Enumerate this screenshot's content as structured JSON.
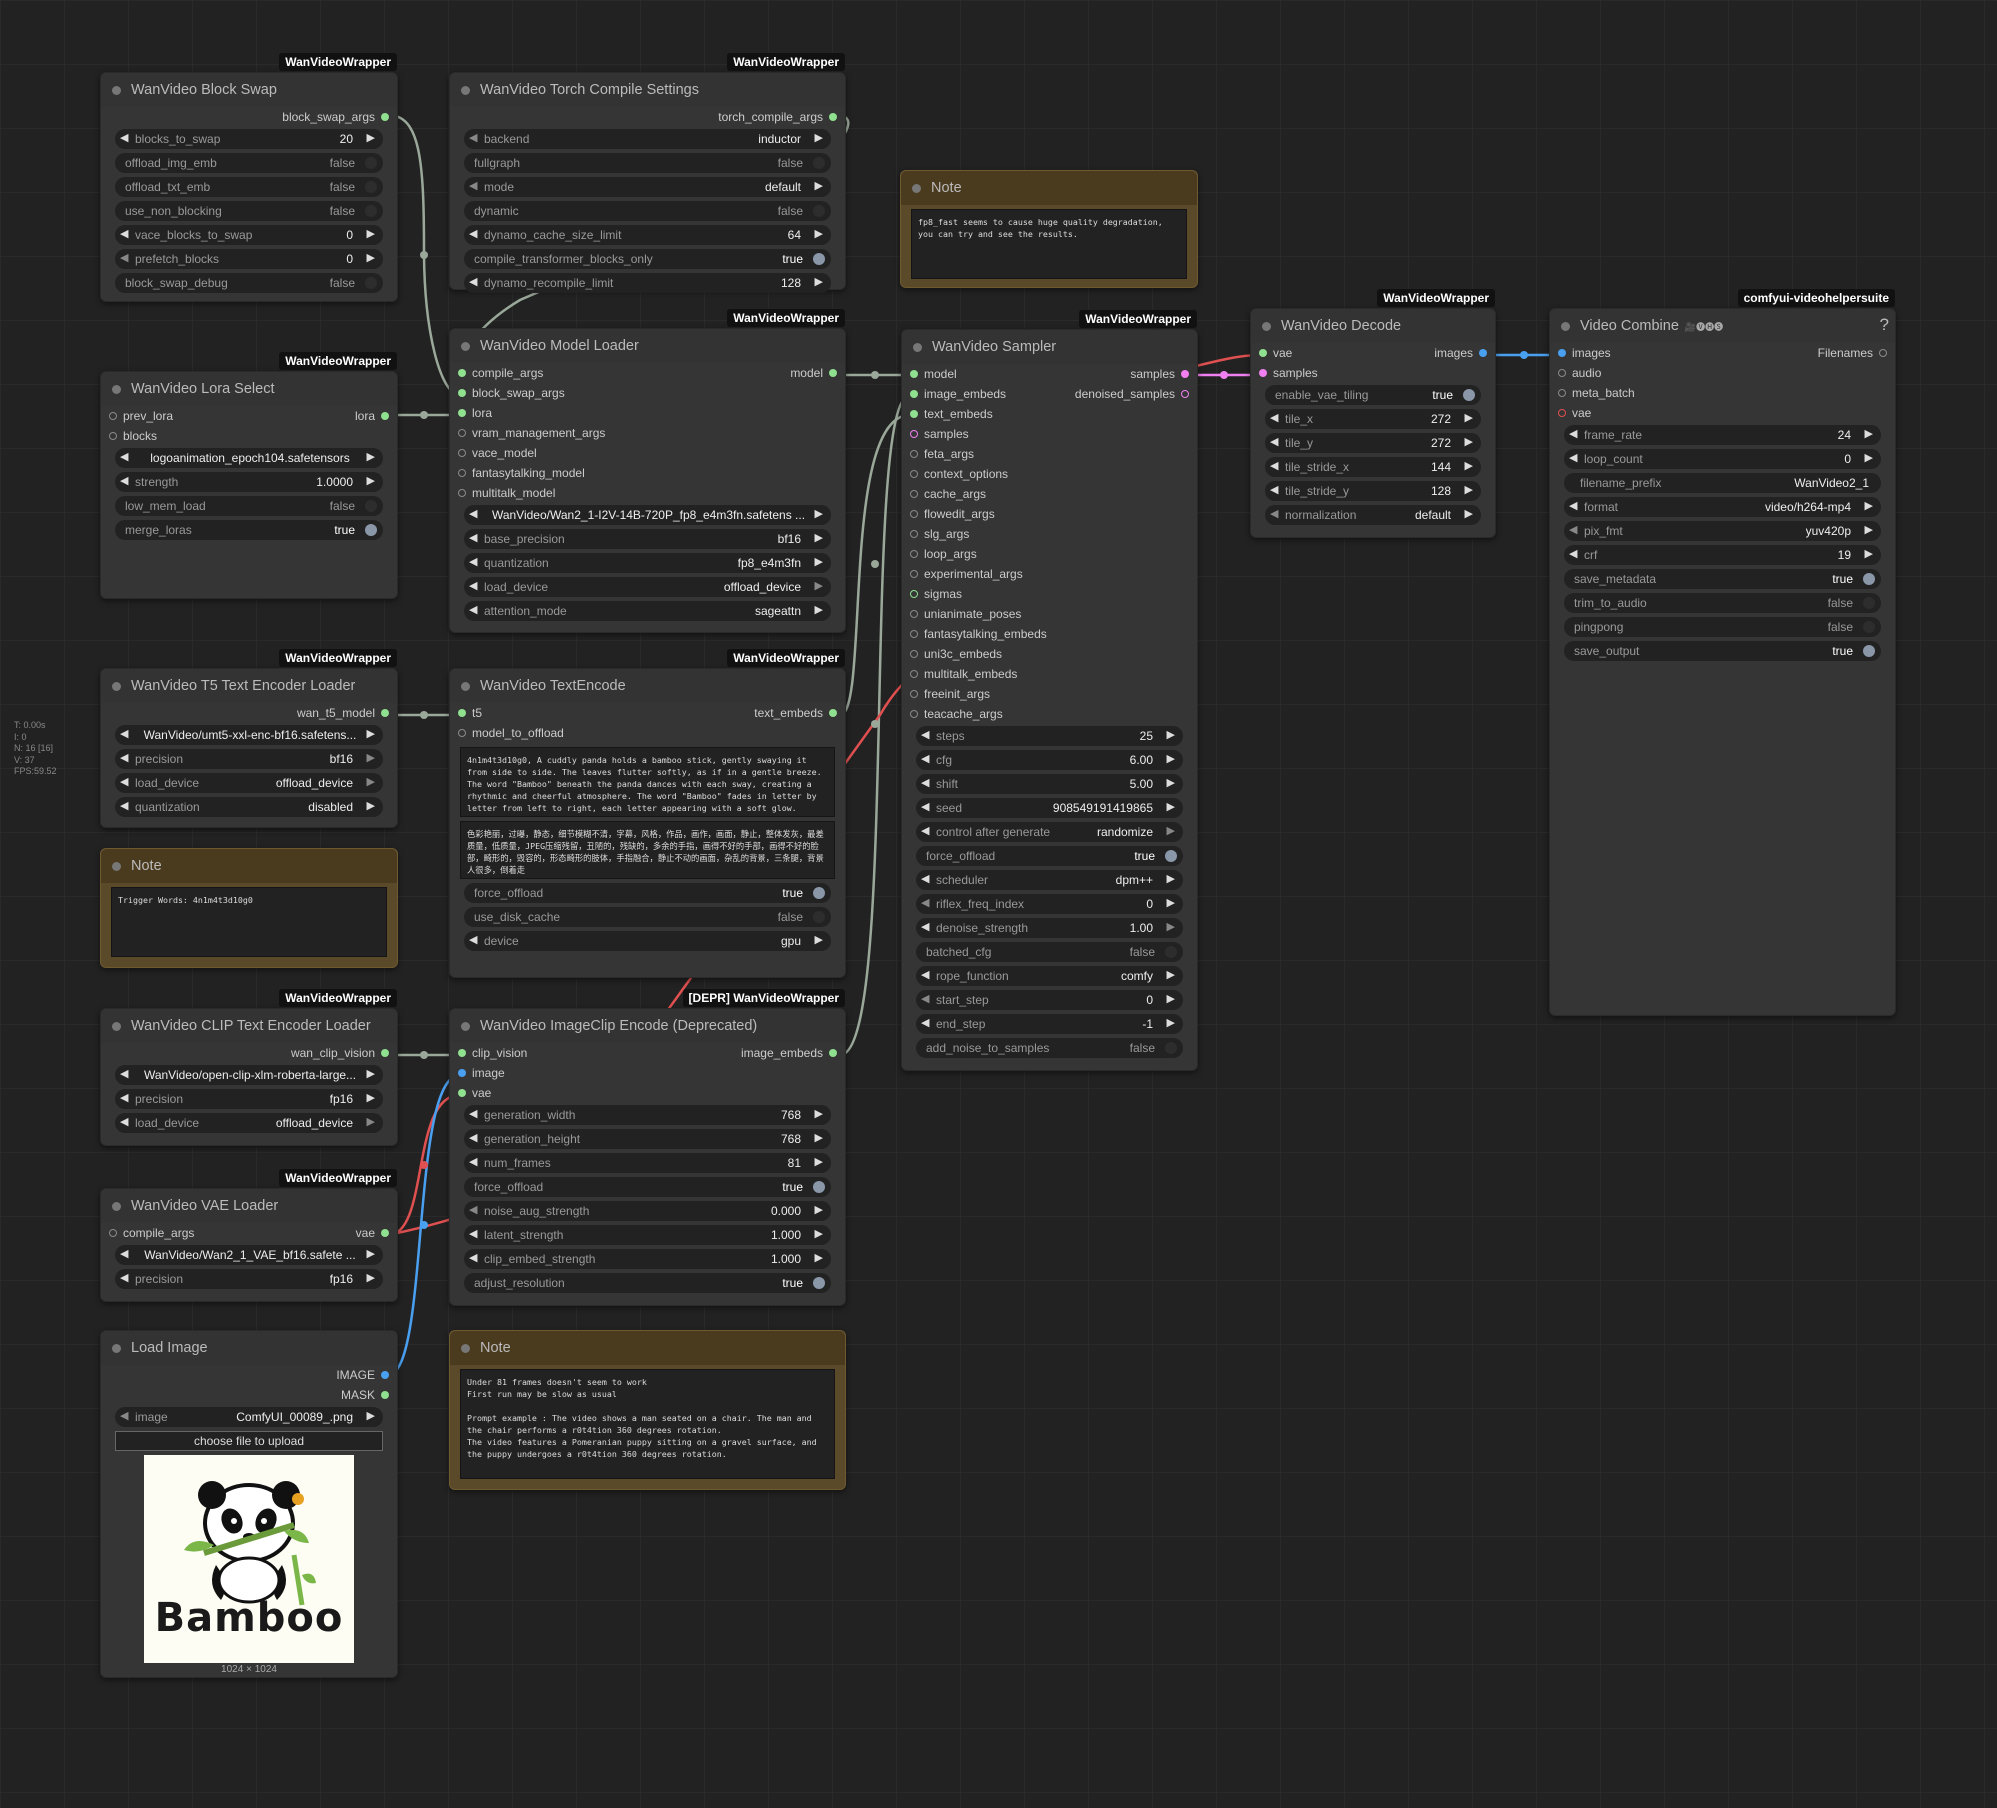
{
  "stats": {
    "t": "T: 0.00s",
    "i": "I: 0",
    "n": "N: 16 [16]",
    "v": "V: 37",
    "fps": "FPS:59.52"
  },
  "block_swap": {
    "badge": "WanVideoWrapper",
    "title": "WanVideo Block Swap",
    "output": "block_swap_args",
    "widgets": [
      {
        "label": "blocks_to_swap",
        "value": "20"
      },
      {
        "label": "offload_img_emb",
        "value": "false"
      },
      {
        "label": "offload_txt_emb",
        "value": "false"
      },
      {
        "label": "use_non_blocking",
        "value": "false"
      },
      {
        "label": "vace_blocks_to_swap",
        "value": "0"
      },
      {
        "label": "prefetch_blocks",
        "value": "0"
      },
      {
        "label": "block_swap_debug",
        "value": "false"
      }
    ]
  },
  "torch_compile": {
    "badge": "WanVideoWrapper",
    "title": "WanVideo Torch Compile Settings",
    "output": "torch_compile_args",
    "widgets": [
      {
        "label": "backend",
        "value": "inductor"
      },
      {
        "label": "fullgraph",
        "value": "false"
      },
      {
        "label": "mode",
        "value": "default"
      },
      {
        "label": "dynamic",
        "value": "false"
      },
      {
        "label": "dynamo_cache_size_limit",
        "value": "64"
      },
      {
        "label": "compile_transformer_blocks_only",
        "value": "true"
      },
      {
        "label": "dynamo_recompile_limit",
        "value": "128"
      }
    ]
  },
  "note_top": {
    "title": "Note",
    "text": "fp8_fast seems to cause huge quality degradation, you can try and see the results."
  },
  "lora_select": {
    "badge": "WanVideoWrapper",
    "title": "WanVideo Lora Select",
    "inputs": [
      "prev_lora",
      "blocks"
    ],
    "output": "lora",
    "widgets": [
      {
        "label": "lora",
        "value": "logoanimation_epoch104.safetensors"
      },
      {
        "label": "strength",
        "value": "1.0000"
      },
      {
        "label": "low_mem_load",
        "value": "false"
      },
      {
        "label": "merge_loras",
        "value": "true"
      }
    ]
  },
  "model_loader": {
    "badge": "WanVideoWrapper",
    "title": "WanVideo Model Loader",
    "inputs": [
      "compile_args",
      "block_swap_args",
      "lora",
      "vram_management_args",
      "vace_model",
      "fantasytalking_model",
      "multitalk_model"
    ],
    "output": "model",
    "widgets": [
      {
        "label": "model",
        "value": "WanVideo/Wan2_1-I2V-14B-720P_fp8_e4m3fn.safetens ..."
      },
      {
        "label": "base_precision",
        "value": "bf16"
      },
      {
        "label": "quantization",
        "value": "fp8_e4m3fn"
      },
      {
        "label": "load_device",
        "value": "offload_device"
      },
      {
        "label": "attention_mode",
        "value": "sageattn"
      }
    ]
  },
  "sampler": {
    "badge": "WanVideoWrapper",
    "title": "WanVideo Sampler",
    "inputs": [
      "model",
      "image_embeds",
      "text_embeds",
      "samples",
      "feta_args",
      "context_options",
      "cache_args",
      "flowedit_args",
      "slg_args",
      "loop_args",
      "experimental_args",
      "sigmas",
      "unianimate_poses",
      "fantasytalking_embeds",
      "uni3c_embeds",
      "multitalk_embeds",
      "freeinit_args",
      "teacache_args"
    ],
    "outputs": [
      "samples",
      "denoised_samples"
    ],
    "widgets": [
      {
        "label": "steps",
        "value": "25"
      },
      {
        "label": "cfg",
        "value": "6.00"
      },
      {
        "label": "shift",
        "value": "5.00"
      },
      {
        "label": "seed",
        "value": "908549191419865"
      },
      {
        "label": "control after generate",
        "value": "randomize"
      },
      {
        "label": "force_offload",
        "value": "true"
      },
      {
        "label": "scheduler",
        "value": "dpm++"
      },
      {
        "label": "riflex_freq_index",
        "value": "0"
      },
      {
        "label": "denoise_strength",
        "value": "1.00"
      },
      {
        "label": "batched_cfg",
        "value": "false"
      },
      {
        "label": "rope_function",
        "value": "comfy"
      },
      {
        "label": "start_step",
        "value": "0"
      },
      {
        "label": "end_step",
        "value": "-1"
      },
      {
        "label": "add_noise_to_samples",
        "value": "false"
      }
    ]
  },
  "decode": {
    "badge": "WanVideoWrapper",
    "title": "WanVideo Decode",
    "inputs": [
      "vae",
      "samples"
    ],
    "output": "images",
    "widgets": [
      {
        "label": "enable_vae_tiling",
        "value": "true"
      },
      {
        "label": "tile_x",
        "value": "272"
      },
      {
        "label": "tile_y",
        "value": "272"
      },
      {
        "label": "tile_stride_x",
        "value": "144"
      },
      {
        "label": "tile_stride_y",
        "value": "128"
      },
      {
        "label": "normalization",
        "value": "default"
      }
    ]
  },
  "video_combine": {
    "badge": "comfyui-videohelpersuite",
    "title": "Video Combine",
    "title_suffix": "🎥🅥🅗🅢",
    "inputs": [
      "images",
      "audio",
      "meta_batch",
      "vae"
    ],
    "output": "Filenames",
    "help": "?",
    "widgets": [
      {
        "label": "frame_rate",
        "value": "24"
      },
      {
        "label": "loop_count",
        "value": "0"
      },
      {
        "label": "filename_prefix",
        "value": "WanVideo2_1"
      },
      {
        "label": "format",
        "value": "video/h264-mp4"
      },
      {
        "label": "pix_fmt",
        "value": "yuv420p"
      },
      {
        "label": "crf",
        "value": "19"
      },
      {
        "label": "save_metadata",
        "value": "true"
      },
      {
        "label": "trim_to_audio",
        "value": "false"
      },
      {
        "label": "pingpong",
        "value": "false"
      },
      {
        "label": "save_output",
        "value": "true"
      }
    ]
  },
  "t5_loader": {
    "badge": "WanVideoWrapper",
    "title": "WanVideo T5 Text Encoder Loader",
    "output": "wan_t5_model",
    "widgets": [
      {
        "label": "model_name",
        "value": "WanVideo/umt5-xxl-enc-bf16.safetens..."
      },
      {
        "label": "precision",
        "value": "bf16"
      },
      {
        "label": "load_device",
        "value": "offload_device"
      },
      {
        "label": "quantization",
        "value": "disabled"
      }
    ]
  },
  "note_trigger": {
    "title": "Note",
    "text": "Trigger Words: 4n1m4t3d10g0"
  },
  "text_encode": {
    "badge": "WanVideoWrapper",
    "title": "WanVideo TextEncode",
    "inputs": [
      "t5",
      "model_to_offload"
    ],
    "output": "text_embeds",
    "positive": "4n1m4t3d10g0, A cuddly panda holds a bamboo stick, gently swaying it from side to side. The leaves flutter softly, as if in a gentle breeze. The word \"Bamboo\" beneath the panda dances with each sway, creating a rhythmic and cheerful atmosphere. The word \"Bamboo\" fades in letter by letter from left to right, each letter appearing with a soft glow.",
    "negative": "色彩艳丽，过曝，静态，细节模糊不清，字幕，风格，作品，画作，画面，静止，整体发灰，最差质量，低质量，JPEG压缩残留，丑陋的，残缺的，多余的手指，画得不好的手部，画得不好的脸部，畸形的，毁容的，形态畸形的肢体，手指融合，静止不动的画面，杂乱的背景，三条腿，背景人很多，倒着走",
    "widgets": [
      {
        "label": "force_offload",
        "value": "true"
      },
      {
        "label": "use_disk_cache",
        "value": "false"
      },
      {
        "label": "device",
        "value": "gpu"
      }
    ]
  },
  "clip_loader": {
    "badge": "WanVideoWrapper",
    "title": "WanVideo CLIP Text Encoder Loader",
    "output": "wan_clip_vision",
    "widgets": [
      {
        "label": "model_name",
        "value": "WanVideo/open-clip-xlm-roberta-large..."
      },
      {
        "label": "precision",
        "value": "fp16"
      },
      {
        "label": "load_device",
        "value": "offload_device"
      }
    ]
  },
  "image_clip": {
    "badge": "[DEPR] WanVideoWrapper",
    "title": "WanVideo ImageClip Encode (Deprecated)",
    "inputs": [
      "clip_vision",
      "image",
      "vae"
    ],
    "output": "image_embeds",
    "widgets": [
      {
        "label": "generation_width",
        "value": "768"
      },
      {
        "label": "generation_height",
        "value": "768"
      },
      {
        "label": "num_frames",
        "value": "81"
      },
      {
        "label": "force_offload",
        "value": "true"
      },
      {
        "label": "noise_aug_strength",
        "value": "0.000"
      },
      {
        "label": "latent_strength",
        "value": "1.000"
      },
      {
        "label": "clip_embed_strength",
        "value": "1.000"
      },
      {
        "label": "adjust_resolution",
        "value": "true"
      }
    ]
  },
  "vae_loader": {
    "badge": "WanVideoWrapper",
    "title": "WanVideo VAE Loader",
    "inputs": [
      "compile_args"
    ],
    "output": "vae",
    "widgets": [
      {
        "label": "model_name",
        "value": "WanVideo/Wan2_1_VAE_bf16.safete ..."
      },
      {
        "label": "precision",
        "value": "fp16"
      }
    ]
  },
  "load_image": {
    "title": "Load Image",
    "outputs": [
      "IMAGE",
      "MASK"
    ],
    "widgets": [
      {
        "label": "image",
        "value": "ComfyUI_00089_.png"
      }
    ],
    "upload": "choose file to upload",
    "preview_word": "Bamboo",
    "dims": "1024 × 1024"
  },
  "note_bottom": {
    "title": "Note",
    "text": "Under 81 frames doesn't seem to work\nFirst run may be slow as usual\n\nPrompt example : The video shows a man seated on a chair. The man and the chair performs a r0t4tion 360 degrees rotation.\nThe video features a Pomeranian puppy sitting on a gravel surface, and the puppy undergoes a r0t4tion 360 degrees rotation."
  },
  "colors": {
    "wire_gray": "#9aa89a",
    "wire_red": "#e05050",
    "wire_pink": "#f080f0",
    "wire_blue": "#4aa0f0",
    "note_bg": "#5a4a2a"
  }
}
